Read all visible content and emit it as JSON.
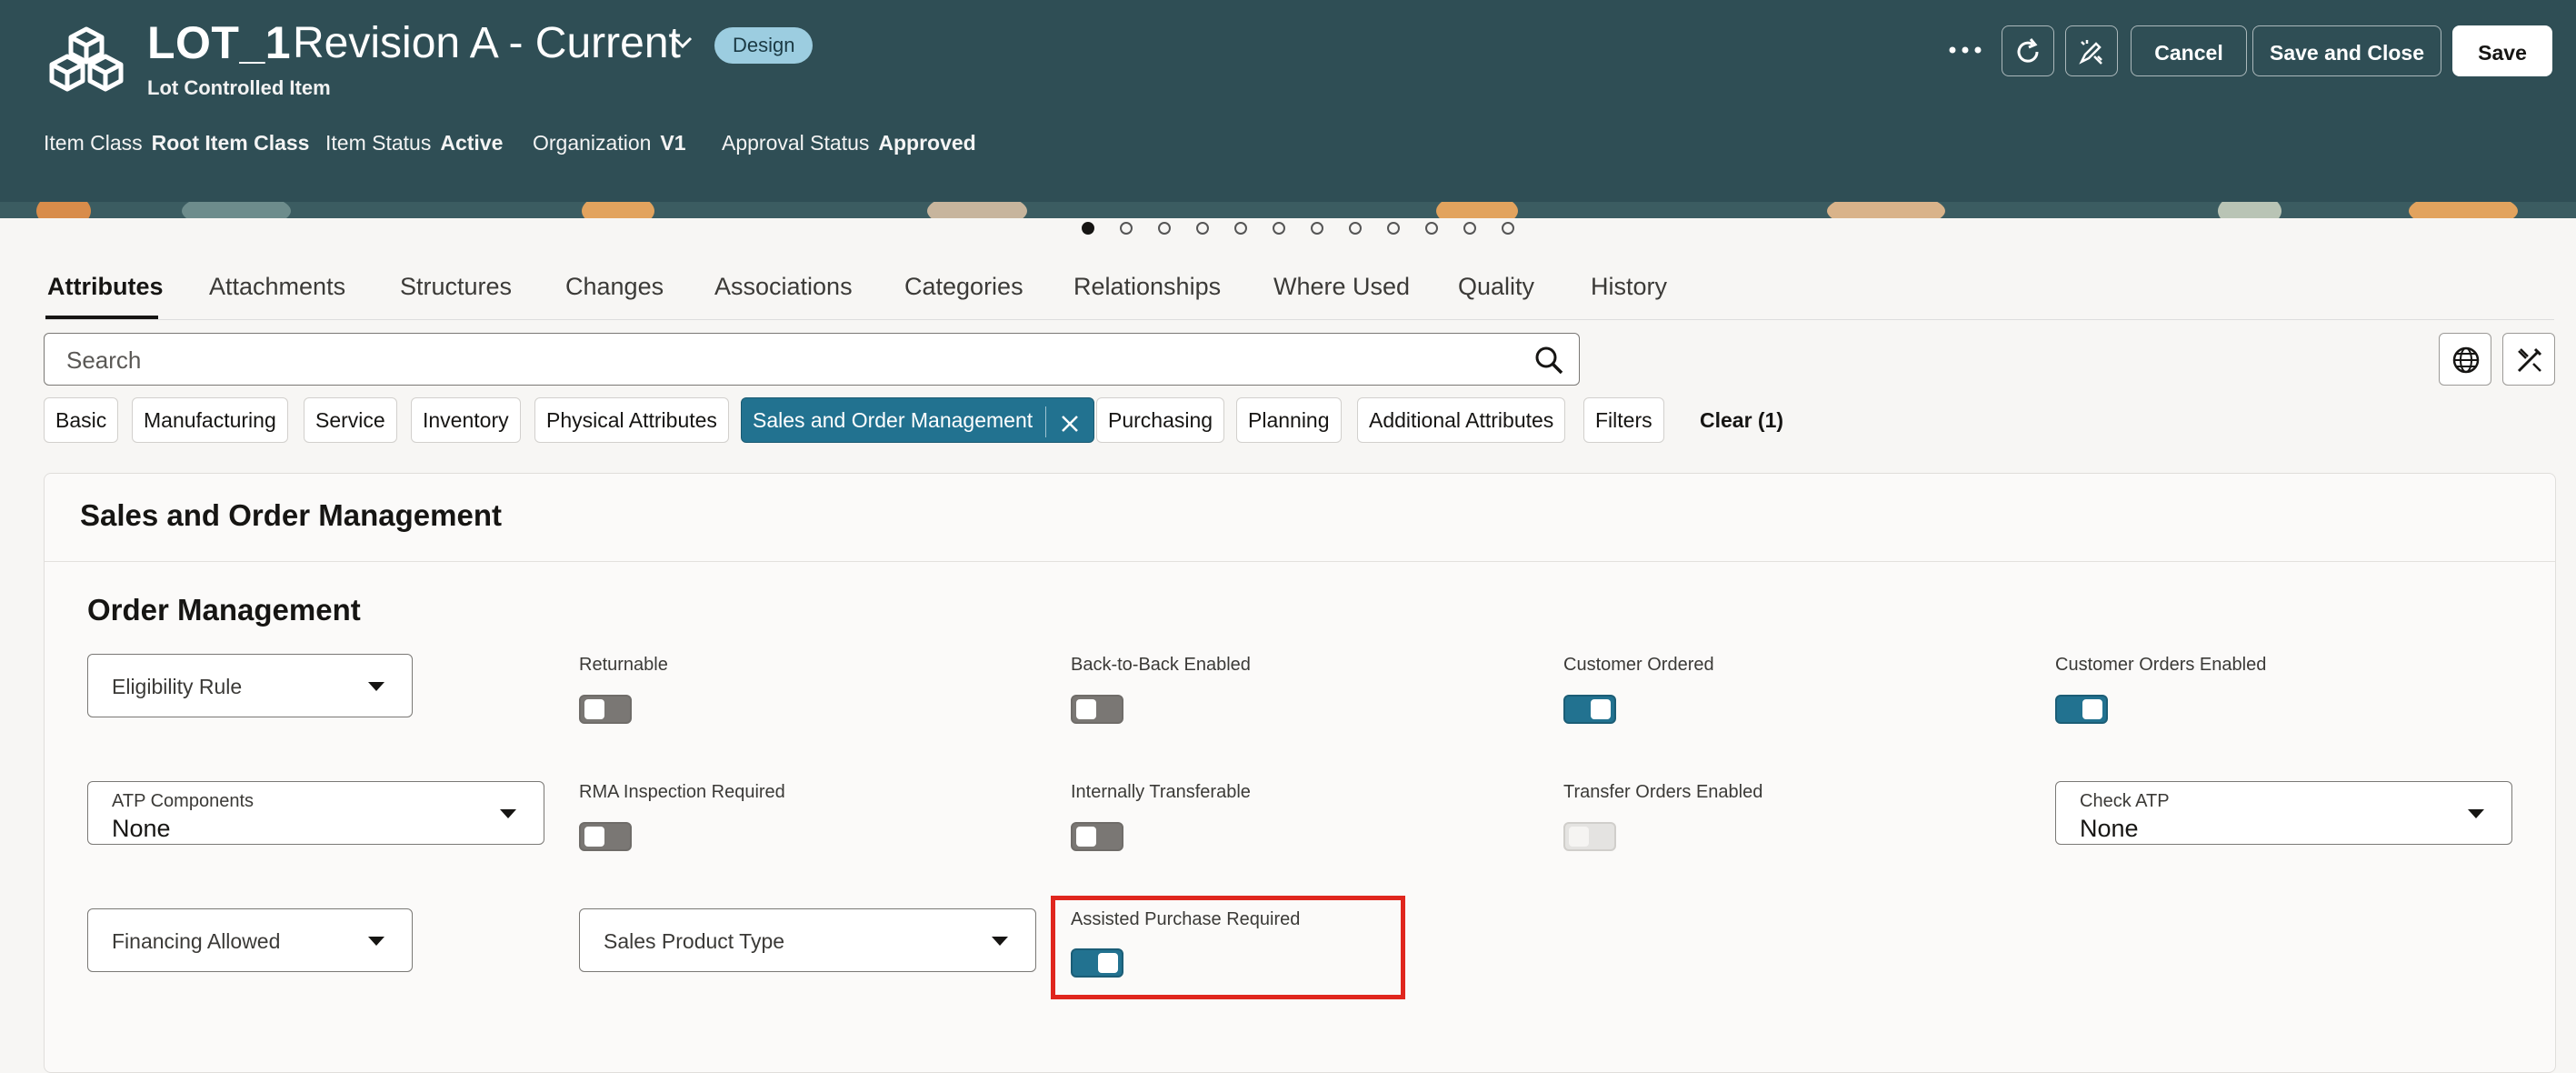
{
  "header": {
    "item_number": "LOT_1",
    "revision": "Revision A - Current",
    "badge": "Design",
    "subtitle": "Lot Controlled Item",
    "meta": [
      {
        "label": "Item Class",
        "value": "Root Item Class"
      },
      {
        "label": "Item Status",
        "value": "Active"
      },
      {
        "label": "Organization",
        "value": "V1"
      },
      {
        "label": "Approval Status",
        "value": "Approved"
      }
    ],
    "buttons": {
      "cancel": "Cancel",
      "save_close": "Save and Close",
      "save": "Save"
    }
  },
  "pager": {
    "count": 12,
    "active_index": 0
  },
  "tabs": [
    "Attributes",
    "Attachments",
    "Structures",
    "Changes",
    "Associations",
    "Categories",
    "Relationships",
    "Where Used",
    "Quality",
    "History"
  ],
  "active_tab": "Attributes",
  "search": {
    "placeholder": "Search"
  },
  "chips": [
    "Basic",
    "Manufacturing",
    "Service",
    "Inventory",
    "Physical Attributes",
    "Sales and Order Management",
    "Purchasing",
    "Planning",
    "Additional Attributes",
    "Filters"
  ],
  "selected_chip": "Sales and Order Management",
  "clear_label": "Clear (1)",
  "panel": {
    "title": "Sales and Order Management",
    "section": "Order Management",
    "eligibility_rule": "Eligibility Rule",
    "atp_components": {
      "label": "ATP Components",
      "value": "None"
    },
    "check_atp": {
      "label": "Check ATP",
      "value": "None"
    },
    "financing_allowed": "Financing Allowed",
    "sales_product_type": "Sales Product Type",
    "toggles": {
      "returnable": {
        "label": "Returnable",
        "state": "off"
      },
      "back_to_back": {
        "label": "Back-to-Back Enabled",
        "state": "off"
      },
      "customer_ordered": {
        "label": "Customer Ordered",
        "state": "on"
      },
      "customer_orders_enabled": {
        "label": "Customer Orders Enabled",
        "state": "on"
      },
      "rma_inspection": {
        "label": "RMA Inspection Required",
        "state": "off"
      },
      "internally_transferable": {
        "label": "Internally Transferable",
        "state": "off"
      },
      "transfer_orders": {
        "label": "Transfer Orders Enabled",
        "state": "disabled"
      },
      "assisted_purchase": {
        "label": "Assisted Purchase Required",
        "state": "on"
      }
    }
  },
  "colors": {
    "header_bg": "#2f4e55",
    "accent": "#227290",
    "highlight": "#e0261e",
    "badge": "#9ccde0"
  },
  "icons": [
    "item-logo-icon",
    "chevron-down-icon",
    "more-icon",
    "refresh-icon",
    "pen-sparkle-icon",
    "search-icon",
    "globe-icon",
    "edit-tools-icon",
    "close-icon",
    "caret-down-icon"
  ]
}
